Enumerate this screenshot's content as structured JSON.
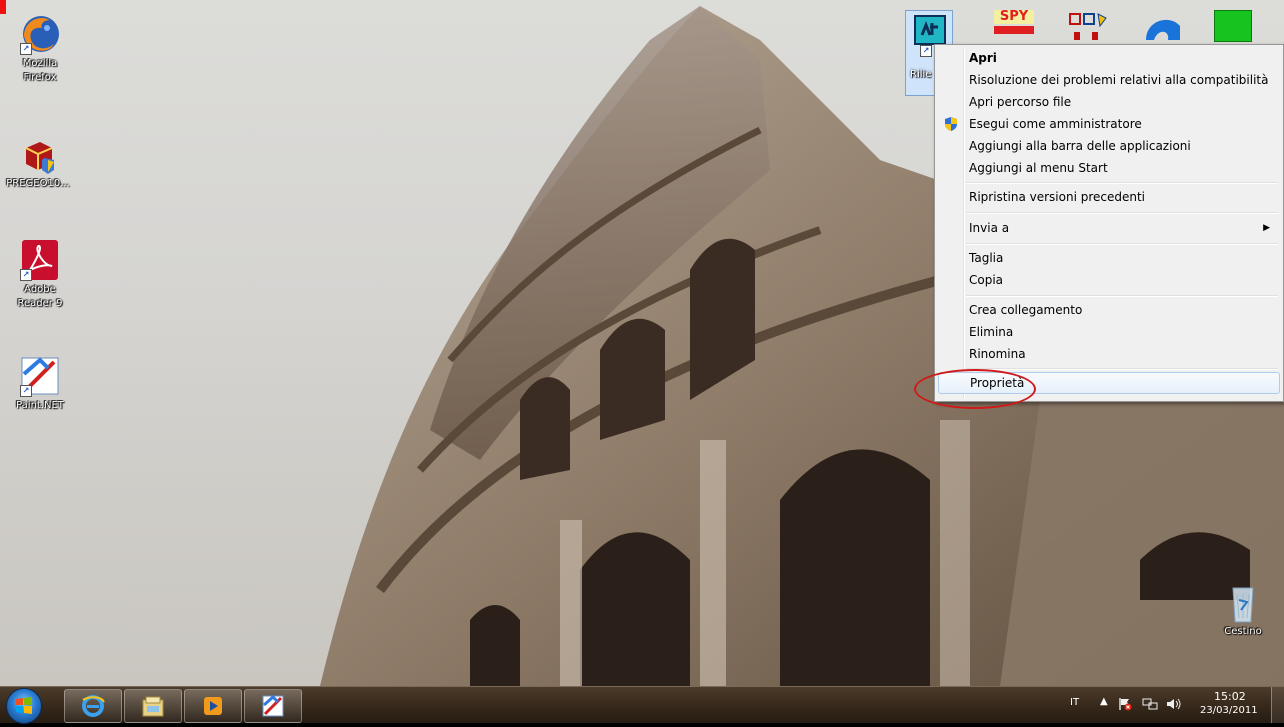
{
  "desktop_icons": [
    {
      "name": "Mozilla Firefox",
      "line1": "Mozilla",
      "line2": "Firefox"
    },
    {
      "name": "PREGEO10...",
      "line1": "PREGEO10...",
      "line2": ""
    },
    {
      "name": "Adobe Reader 9",
      "line1": "Adobe",
      "line2": "Reader 9"
    },
    {
      "name": "Paint.NET",
      "line1": "Paint.NET",
      "line2": ""
    }
  ],
  "selected_icon_label": "Rilie",
  "top_icons": {
    "spy": "SPY",
    "colors": {
      "selected_bg": "#cfe3fb",
      "spy_red": "#e02020",
      "green": "#17c41f"
    }
  },
  "context_menu": {
    "items": [
      {
        "label": "Apri",
        "bold": true
      },
      {
        "label": "Risoluzione dei problemi relativi alla compatibilità"
      },
      {
        "label": "Apri percorso file"
      },
      {
        "label": "Esegui come amministratore",
        "icon": "uac-shield-icon"
      },
      {
        "label": "Aggiungi alla barra delle applicazioni"
      },
      {
        "label": "Aggiungi al menu Start"
      },
      {
        "label": "Ripristina versioni precedenti"
      },
      {
        "label": "Invia a",
        "submenu": true
      },
      {
        "label": "Taglia"
      },
      {
        "label": "Copia"
      },
      {
        "label": "Crea collegamento"
      },
      {
        "label": "Elimina"
      },
      {
        "label": "Rinomina"
      },
      {
        "label": "Proprietà",
        "highlighted": true
      }
    ]
  },
  "recycle_bin": {
    "label": "Cestino"
  },
  "taskbar": {
    "pinned": [
      "internet-explorer-icon",
      "windows-explorer-icon",
      "media-player-icon",
      "paint-net-icon"
    ],
    "tray": {
      "language": "IT",
      "time": "15:02",
      "date": "23/03/2011"
    }
  }
}
